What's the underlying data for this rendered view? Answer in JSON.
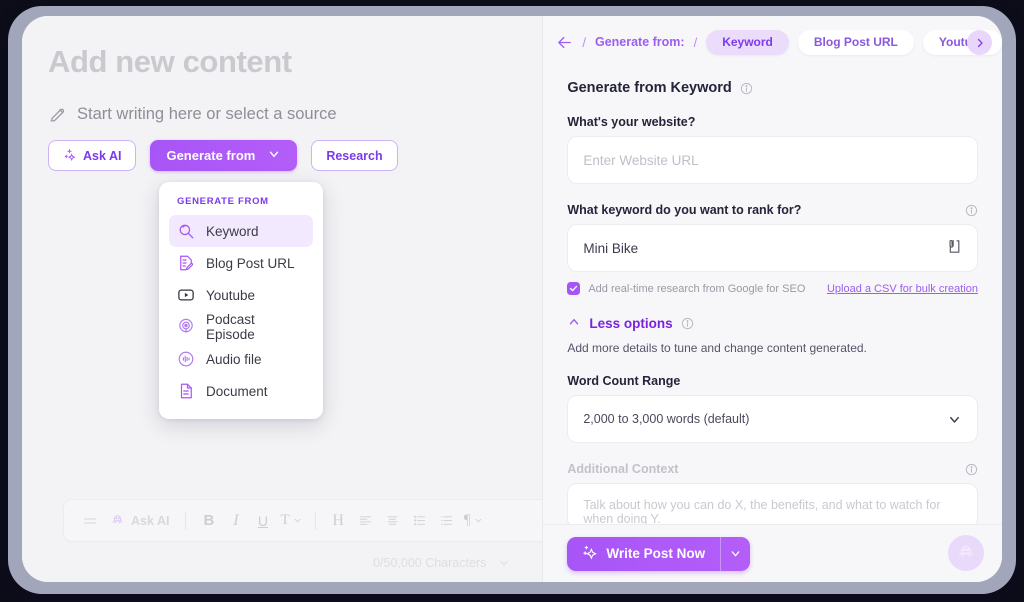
{
  "editor": {
    "title": "Add new content",
    "subtitle": "Start writing here or select a source",
    "ask_ai_label": "Ask AI",
    "generate_from_label": "Generate from",
    "research_label": "Research",
    "char_counter": "0/50,000 Characters",
    "toolbar": {
      "ask_ai_label": "Ask AI",
      "bold": "B",
      "italic": "I",
      "underline": "U",
      "text_style": "T",
      "heading": "H",
      "align_left": "align-left",
      "align_center": "align-center",
      "bullet_list": "bullet-list",
      "numbered_list": "numbered-list",
      "paragraph": "¶",
      "more": "more"
    }
  },
  "dropdown": {
    "heading": "GENERATE FROM",
    "items": [
      {
        "label": "Keyword",
        "icon": "keyword-icon",
        "active": true
      },
      {
        "label": "Blog Post URL",
        "icon": "blog-post-url-icon",
        "active": false
      },
      {
        "label": "Youtube",
        "icon": "youtube-icon",
        "active": false
      },
      {
        "label": "Podcast Episode",
        "icon": "podcast-icon",
        "active": false
      },
      {
        "label": "Audio file",
        "icon": "audio-file-icon",
        "active": false
      },
      {
        "label": "Document",
        "icon": "document-icon",
        "active": false
      }
    ]
  },
  "panel": {
    "breadcrumb": {
      "back": "back-arrow",
      "sep": "/",
      "label": "Generate from:"
    },
    "chips": [
      {
        "label": "Keyword",
        "selected": true
      },
      {
        "label": "Blog Post URL",
        "selected": false
      },
      {
        "label": "Youtube",
        "selected": false
      }
    ],
    "next_chevron": "›",
    "heading": "Generate from Keyword",
    "website_label": "What's your website?",
    "website_placeholder": "Enter Website URL",
    "keyword_label": "What keyword do you want to rank for?",
    "keyword_value": "Mini Bike",
    "checkbox_label": "Add real-time research from Google for SEO",
    "checkbox_checked": true,
    "csv_link": "Upload a CSV for bulk creation",
    "less_options_label": "Less options",
    "less_options_desc": "Add more details to tune and change content generated.",
    "word_count_label": "Word Count Range",
    "word_count_value": "2,000 to 3,000 words (default)",
    "additional_context_label": "Additional Context",
    "additional_context_placeholder": "Talk about how you can do X, the benefits, and what to watch for when doing Y.",
    "write_post_label": "Write Post Now",
    "write_post_caret": "chevron-down",
    "octopus_fab": "octopus-icon"
  },
  "colors": {
    "accent": "#a855f7",
    "accent_dark": "#7c3aed",
    "chip_selected_bg": "#ecdcfc",
    "frame": "#a2a6ba",
    "panel_bg": "#f7f7f9"
  }
}
